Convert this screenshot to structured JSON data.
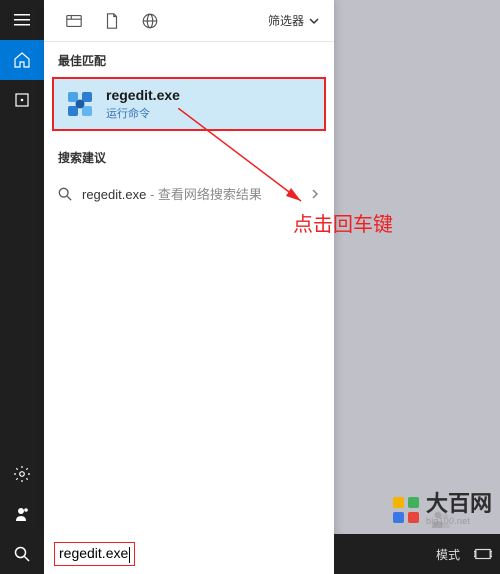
{
  "tabs": {
    "filter_label": "筛选器"
  },
  "sections": {
    "best_match": "最佳匹配",
    "suggestions": "搜索建议"
  },
  "best_match": {
    "title": "regedit.exe",
    "subtitle": "运行命令"
  },
  "suggestions": {
    "items": [
      {
        "text": "regedit.exe",
        "suffix": " - 查看网络搜索结果"
      }
    ]
  },
  "search": {
    "value": "regedit.exe"
  },
  "annotation": {
    "text": "点击回车键"
  },
  "taskbar": {
    "mode_label": "模式"
  },
  "watermark": {
    "main": "大百网",
    "sub": "big100.net"
  }
}
